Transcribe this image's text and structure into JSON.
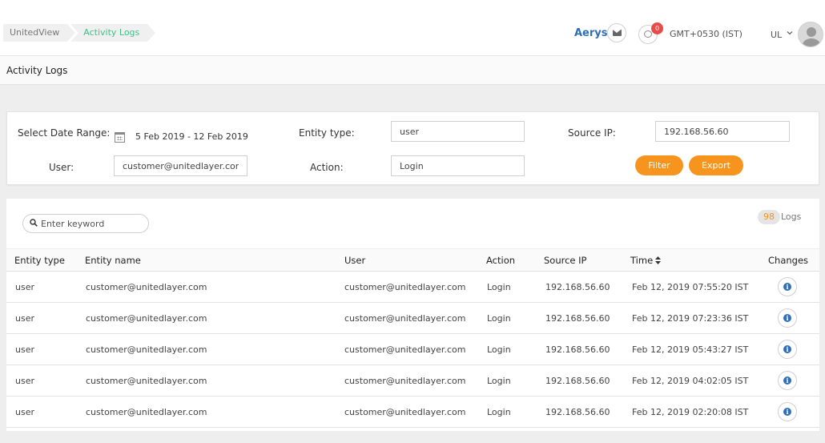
{
  "breadcrumb": [
    "UnitedView",
    "Activity Logs"
  ],
  "header": {
    "org_name": "Aerys",
    "notification_count": "0",
    "timezone": "GMT+0530 (IST)",
    "user_initials": "UL"
  },
  "page_title": "Activity Logs",
  "filters": {
    "date_range_label": "Select Date Range:",
    "date_range_value": "5 Feb 2019 - 12 Feb 2019",
    "entity_type_label": "Entity type:",
    "entity_type_value": "user",
    "source_ip_label": "Source IP:",
    "source_ip_value": "192.168.56.60",
    "user_label": "User:",
    "user_value": "customer@unitedlayer.com",
    "action_label": "Action:",
    "action_value": "Login",
    "filter_button": "Filter",
    "export_button": "Export"
  },
  "logs": {
    "search_placeholder": "Enter keyword",
    "count": "98",
    "count_label": "Logs",
    "columns": [
      "Entity type",
      "Entity name",
      "User",
      "Action",
      "Source IP",
      "Time",
      "Changes"
    ],
    "rows": [
      [
        "user",
        "customer@unitedlayer.com",
        "customer@unitedlayer.com",
        "Login",
        "192.168.56.60",
        "Feb 12, 2019 07:55:20 IST"
      ],
      [
        "user",
        "customer@unitedlayer.com",
        "customer@unitedlayer.com",
        "Login",
        "192.168.56.60",
        "Feb 12, 2019 07:23:36 IST"
      ],
      [
        "user",
        "customer@unitedlayer.com",
        "customer@unitedlayer.com",
        "Login",
        "192.168.56.60",
        "Feb 12, 2019 05:43:27 IST"
      ],
      [
        "user",
        "customer@unitedlayer.com",
        "customer@unitedlayer.com",
        "Login",
        "192.168.56.60",
        "Feb 12, 2019 04:02:05 IST"
      ],
      [
        "user",
        "customer@unitedlayer.com",
        "customer@unitedlayer.com",
        "Login",
        "192.168.56.60",
        "Feb 12, 2019 02:20:08 IST"
      ]
    ]
  },
  "colors": {
    "accent": "#f7941d",
    "link": "#2f6fb5",
    "breadcrumb_active": "#3fbf8c",
    "badge": "#e84a4a"
  },
  "icons": {
    "mail": "mail-icon",
    "notification": "chat-bubble-icon",
    "calendar": "calendar-icon",
    "search": "search-icon",
    "sort": "sort-icon",
    "info": "info-icon",
    "avatar": "user-avatar-icon"
  }
}
